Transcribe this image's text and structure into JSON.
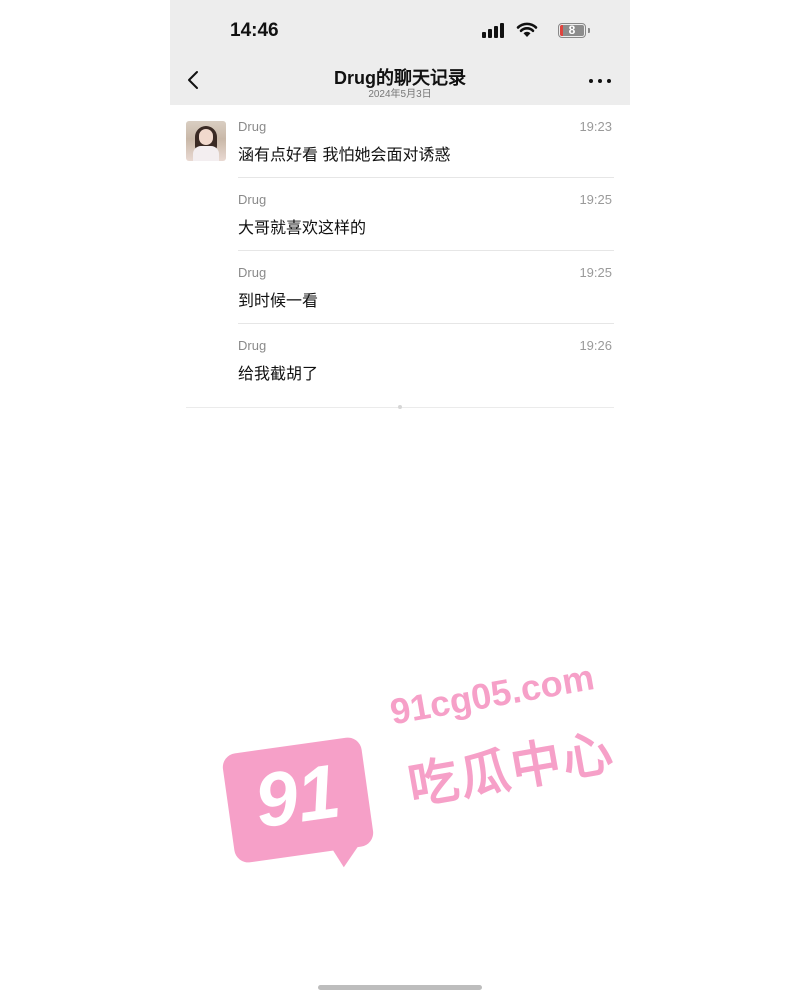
{
  "status_bar": {
    "time": "14:46",
    "battery_level": "8"
  },
  "nav": {
    "title": "Drug的聊天记录",
    "subtitle": "2024年5月3日",
    "back_icon": "chevron-left-icon",
    "more_icon": "more-dots-icon"
  },
  "messages": [
    {
      "sender": "Drug",
      "time": "19:23",
      "text": "涵有点好看 我怕她会面对诱惑"
    },
    {
      "sender": "Drug",
      "time": "19:25",
      "text": "大哥就喜欢这样的"
    },
    {
      "sender": "Drug",
      "time": "19:25",
      "text": "到时候一看"
    },
    {
      "sender": "Drug",
      "time": "19:26",
      "text": "给我截胡了"
    }
  ],
  "watermark": {
    "badge": "91",
    "url": "91cg05.com",
    "name": "吃瓜中心"
  },
  "colors": {
    "bar_bg": "#ededed",
    "watermark": "#f6a0c8"
  }
}
